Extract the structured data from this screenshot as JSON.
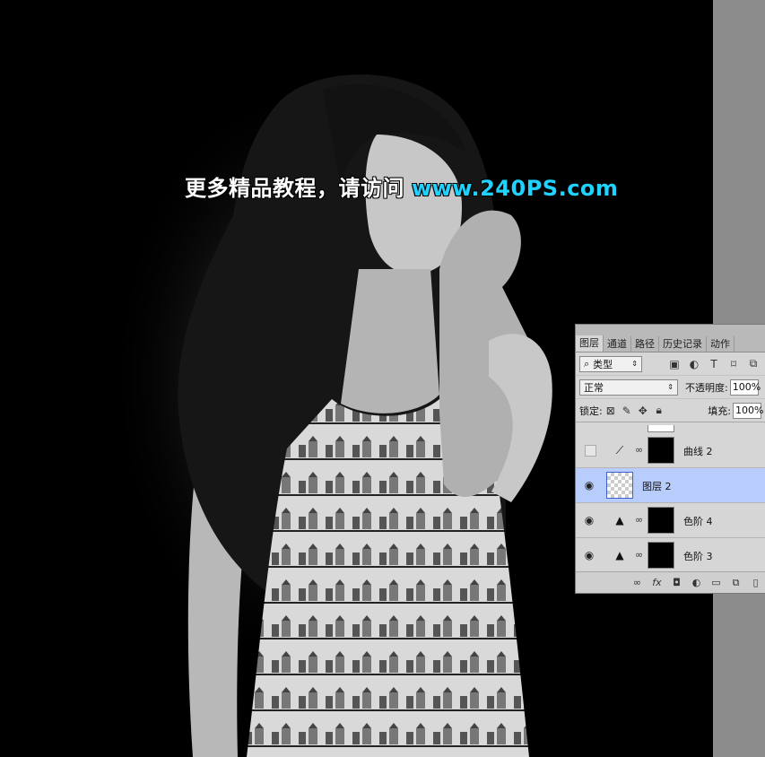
{
  "watermark": {
    "text_cn": "更多精品教程，请访问",
    "url": "www.240PS.com"
  },
  "panel": {
    "tabs": [
      "图层",
      "通道",
      "路径",
      "历史记录",
      "动作"
    ],
    "filter": {
      "icon": "search-icon",
      "label": "类型"
    },
    "blend_mode": "正常",
    "opacity_label": "不透明度:",
    "opacity_value": "100%",
    "lock_label": "锁定:",
    "fill_label": "填充:",
    "fill_value": "100%",
    "layers": [
      {
        "name": "曲线 2",
        "visible": false,
        "type": "curves-adjustment"
      },
      {
        "name": "图层 2",
        "visible": true,
        "type": "pixel",
        "selected": true
      },
      {
        "name": "色阶 4",
        "visible": true,
        "type": "levels-adjustment"
      },
      {
        "name": "色阶 3",
        "visible": true,
        "type": "levels-adjustment"
      }
    ]
  }
}
